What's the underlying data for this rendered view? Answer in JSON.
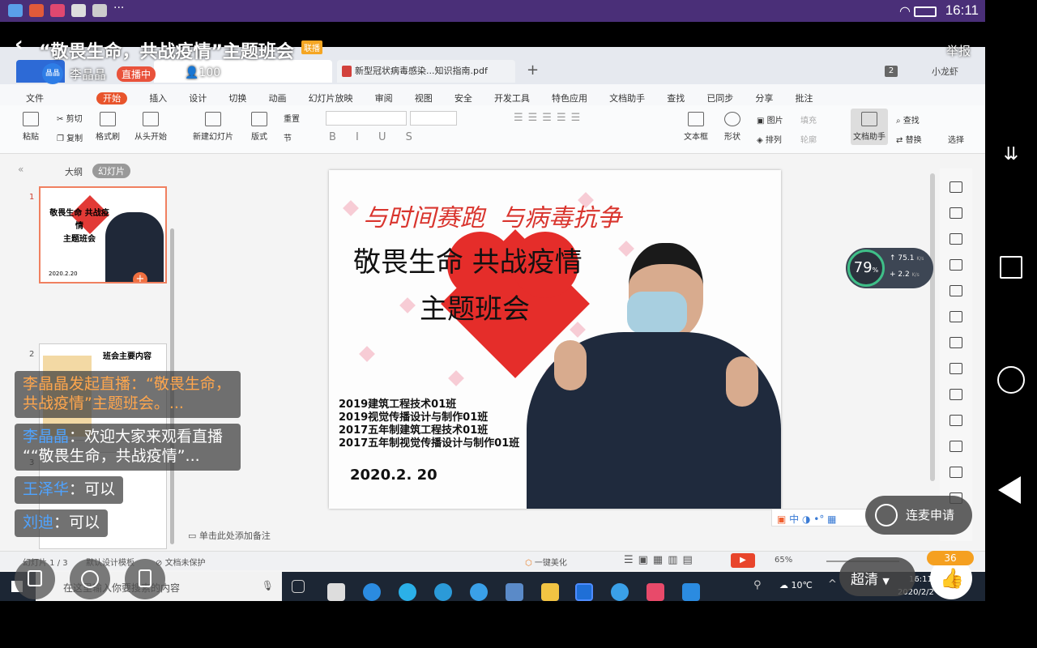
{
  "statusbar": {
    "time": "16:11"
  },
  "live": {
    "title": "“敬畏生命，共战疫情”主题班会",
    "title_badge": "联播",
    "report_label": "举报",
    "host_name": "李晶晶",
    "host_avatar_text": "晶晶",
    "live_badge": "直播中",
    "viewer_count": "100",
    "quality_label": "超清",
    "like_count": "36",
    "mic_request_label": "连麦申请"
  },
  "wps": {
    "tabs": [
      "新型冠状病毒感染...知识指南.pdf"
    ],
    "top_right_badge": "2",
    "user_name": "小龙虾",
    "menu": [
      "文件",
      "开始",
      "插入",
      "设计",
      "切换",
      "动画",
      "幻灯片放映",
      "审阅",
      "视图",
      "安全",
      "开发工具",
      "特色应用",
      "文档助手",
      "查找"
    ],
    "menu_right": [
      "已同步",
      "分享",
      "批注"
    ],
    "toolbar": {
      "paste": "粘贴",
      "cut": "剪切",
      "copy": "复制",
      "format_painter": "格式刷",
      "from_start": "从头开始",
      "new_slide": "新建幻灯片",
      "layout": "版式",
      "reset": "重置",
      "section": "节",
      "textbox": "文本框",
      "shape": "形状",
      "picture": "图片",
      "arrange": "排列",
      "fill": "填充",
      "outline": "轮廓",
      "doc_helper": "文档助手",
      "find": "查找",
      "replace": "替换",
      "select": "选择"
    },
    "panel_tabs": [
      "大纲",
      "幻灯片"
    ],
    "thumb1": {
      "num": "1",
      "title1": "敬畏生命 共战疫情",
      "title2": "主题班会",
      "date": "2020.2.20"
    },
    "thumb2": {
      "num": "2",
      "title": "班会主要内容"
    },
    "thumb3": {
      "num": "3"
    },
    "slide": {
      "calligraphy": "与时间赛跑  与病毒抗争",
      "title_line1": "敬畏生命 共战疫情",
      "title_line2": "主题班会",
      "classes": [
        "2019建筑工程技术01班",
        "2019视觉传播设计与制作01班",
        "2017五年制建筑工程技术01班",
        "2017五年制视觉传播设计与制作01班"
      ],
      "date": "2020.2. 20"
    },
    "notes_placeholder": "单击此处添加备注",
    "statusbar": {
      "slide_count": "幻灯片 1 / 3",
      "template": "默认设计模板",
      "protect": "文档未保护",
      "beautify": "一键美化",
      "zoom": "65%"
    },
    "ime": [
      "中"
    ],
    "net_widget": {
      "percent": "79",
      "up": "75.1",
      "down": "2.2",
      "unit": "K/s"
    }
  },
  "taskbar": {
    "search_placeholder": "在这里输入你要搜索的内容",
    "weather": "10℃",
    "clock_time": "16:11",
    "clock_date": "2020/2/2"
  },
  "chat": [
    {
      "name": "李晶晶",
      "sep": "发起直播：",
      "text": "“敬畏生命，共战疫情”主题班会。..."
    },
    {
      "name": "李晶晶",
      "sep": "：",
      "text": "欢迎大家来观看直播 ““敬畏生命，共战疫情”..."
    },
    {
      "name": "王泽华",
      "sep": "：",
      "text": "可以"
    },
    {
      "name": "刘迪",
      "sep": "：",
      "text": "可以"
    }
  ]
}
